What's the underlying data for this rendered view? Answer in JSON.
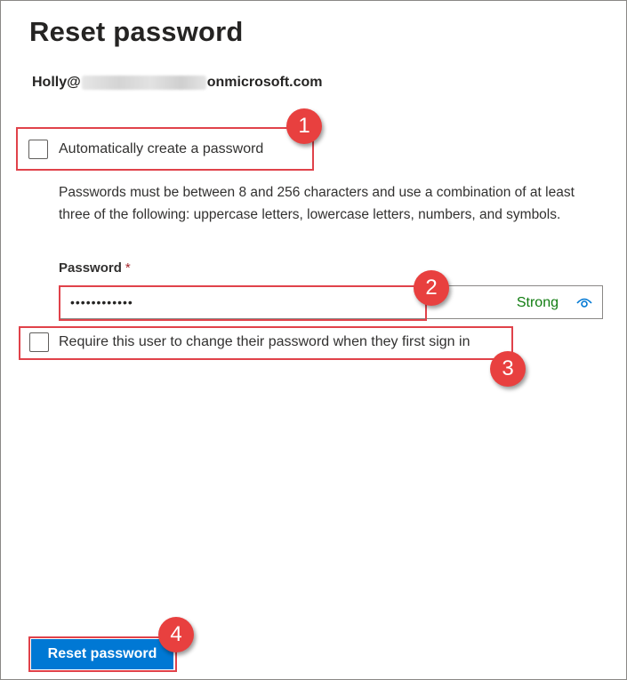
{
  "page": {
    "title": "Reset password"
  },
  "user": {
    "name_prefix": "Holly@",
    "domain_suffix": "onmicrosoft.com"
  },
  "auto_password": {
    "label": "Automatically create a password",
    "checked": false
  },
  "help_text": "Passwords must be between 8 and 256 characters and use a combination of at least three of the following: uppercase letters, lowercase letters, numbers, and symbols.",
  "password": {
    "label": "Password",
    "required_marker": "*",
    "masked_value": "••••••••••••",
    "strength": "Strong"
  },
  "require_change": {
    "label": "Require this user to change their password when they first sign in",
    "checked": false
  },
  "actions": {
    "reset_label": "Reset password"
  },
  "callouts": [
    "1",
    "2",
    "3",
    "4"
  ],
  "colors": {
    "accent": "#0078d4",
    "callout": "#e8403f",
    "strength": "#107c10"
  }
}
